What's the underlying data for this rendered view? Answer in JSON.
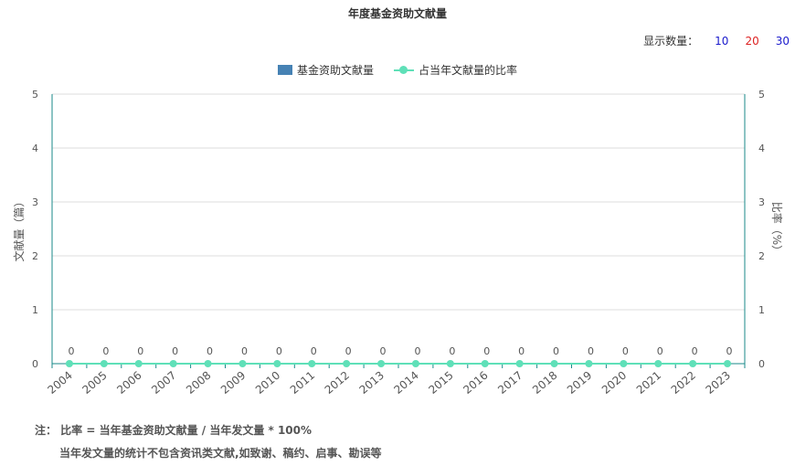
{
  "header": {
    "title": "年度基金资助文献量"
  },
  "count_selector": {
    "label": "显示数量：",
    "options": [
      {
        "label": "10",
        "color": "#1a1acc"
      },
      {
        "label": "20",
        "color": "#dd2222"
      },
      {
        "label": "30",
        "color": "#1a1acc"
      }
    ]
  },
  "legend": [
    {
      "label": "基金资助文献量",
      "color": "#4682b4",
      "kind": "bar"
    },
    {
      "label": "占当年文献量的比率",
      "color": "#5fe0b8",
      "kind": "line"
    }
  ],
  "chart_data": {
    "type": "bar",
    "title": "年度基金资助文献量",
    "categories": [
      "2004",
      "2005",
      "2006",
      "2007",
      "2008",
      "2009",
      "2010",
      "2011",
      "2012",
      "2013",
      "2014",
      "2015",
      "2016",
      "2017",
      "2018",
      "2019",
      "2020",
      "2021",
      "2022",
      "2023"
    ],
    "series": [
      {
        "name": "基金资助文献量",
        "type": "bar",
        "axis": "left",
        "color": "#4682b4",
        "values": [
          0,
          0,
          0,
          0,
          0,
          0,
          0,
          0,
          0,
          0,
          0,
          0,
          0,
          0,
          0,
          0,
          0,
          0,
          0,
          0
        ]
      },
      {
        "name": "占当年文献量的比率",
        "type": "line",
        "axis": "right",
        "color": "#5fe0b8",
        "values": [
          0,
          0,
          0,
          0,
          0,
          0,
          0,
          0,
          0,
          0,
          0,
          0,
          0,
          0,
          0,
          0,
          0,
          0,
          0,
          0
        ]
      }
    ],
    "ylabel": "文献量（篇）",
    "y2label": "比率（%）",
    "ylim": [
      0,
      5
    ],
    "y2lim": [
      0,
      5
    ],
    "yticks": [
      "0",
      "1",
      "2",
      "3",
      "4",
      "5"
    ],
    "y2ticks": [
      "0",
      "1",
      "2",
      "3",
      "4",
      "5"
    ],
    "data_labels": [
      "0",
      "0",
      "0",
      "0",
      "0",
      "0",
      "0",
      "0",
      "0",
      "0",
      "0",
      "0",
      "0",
      "0",
      "0",
      "0",
      "0",
      "0",
      "0",
      "0"
    ],
    "grid": true,
    "legend_position": "top-center"
  },
  "notes": {
    "line1": "注：  比率 = 当年基金资助文献量 / 当年发文量 * 100%",
    "line2": "当年发文量的统计不包含资讯类文献,如致谢、稿约、启事、勘误等"
  }
}
